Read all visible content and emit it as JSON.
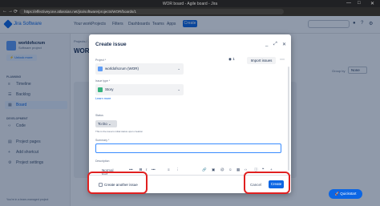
{
  "browser": {
    "tab_title": "WOR board - Agile board - Jira",
    "url": "https://effectiveyone.atlassian.net/jira/software/projects/WOR/boards/1",
    "back": "←",
    "forward": "→",
    "reload": "⟳",
    "minimize": "—",
    "maximize": "□",
    "close": "✕"
  },
  "topnav": {
    "product": "Jira Software",
    "menu": [
      "Your work",
      "Projects",
      "Filters",
      "Dashboards",
      "Teams",
      "Apps"
    ],
    "create": "Create",
    "icons": [
      "bell-icon",
      "help-icon",
      "settings-icon",
      "avatar"
    ]
  },
  "sidebar": {
    "project_name": "worldofscrum",
    "project_type": "Software project",
    "unlock": "⚡ Unlock more",
    "planning_label": "PLANNING",
    "items": [
      {
        "label": "Timeline",
        "icon": "≡"
      },
      {
        "label": "Backlog",
        "icon": "☰"
      },
      {
        "label": "Board",
        "icon": "▦"
      }
    ],
    "development_label": "DEVELOPMENT",
    "dev_items": [
      {
        "label": "Code",
        "icon": "‹›"
      },
      {
        "label": "Project pages",
        "icon": "▤"
      },
      {
        "label": "Add shortcut",
        "icon": "+"
      },
      {
        "label": "Project settings",
        "icon": "⚙"
      }
    ],
    "footer": "You're in a team-managed project"
  },
  "main": {
    "breadcrumbs": "Projects / ...",
    "title": "WOR",
    "groupby": "Group by",
    "groupby_value": "None"
  },
  "modal": {
    "title": "Create issue",
    "import_badge": "1",
    "import_button": "Import issues",
    "project_label": "Project *",
    "project_value": "worldofscrum (WOR)",
    "issue_type_label": "Issue type *",
    "issue_type_value": "Story",
    "learn_more": "Learn more",
    "status_label": "Status",
    "status_value": "To Do",
    "status_note": "This is the issue's initial status upon creation",
    "summary_label": "Summary *",
    "description_label": "Description",
    "toolbar": {
      "text_style": "Normal text",
      "more": "•••",
      "bold": "B",
      "italic": "I",
      "more2": "•••",
      "list": "≡",
      "numbered": "⋮",
      "link": "🔗",
      "image": "▣",
      "mention": "@",
      "emoji": "☺",
      "table": "▦",
      "code": "‹›",
      "info": "ⓘ",
      "quote": "❝",
      "plus": "+"
    },
    "create_another": "Create another issue",
    "cancel": "Cancel",
    "create": "Create"
  },
  "quickstart": "Quickstart"
}
